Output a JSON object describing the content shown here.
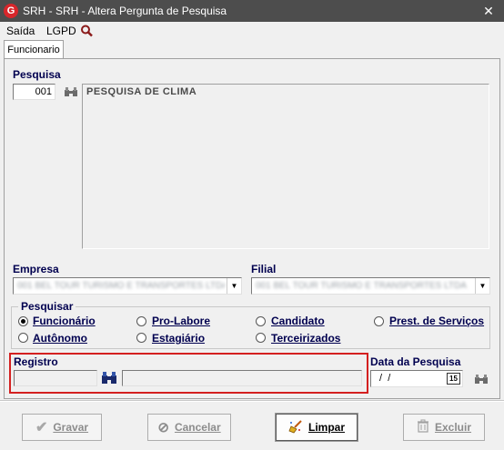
{
  "window": {
    "title": "SRH -  SRH - Altera Pergunta de Pesquisa",
    "close_glyph": "✕",
    "app_icon_letter": "G"
  },
  "menu": {
    "saida": "Saída",
    "lgpd": "LGPD",
    "search_icon": "magnifier-icon"
  },
  "tabs": {
    "funcionario": "Funcionario"
  },
  "pesquisa": {
    "label": "Pesquisa",
    "code": "001",
    "description": "PESQUISA DE CLIMA"
  },
  "empresa": {
    "label": "Empresa",
    "value": "001 BEL TOUR TURISMO E TRANSPORTES LTDA"
  },
  "filial": {
    "label": "Filial",
    "value": "001 BEL TOUR TURISMO E TRANSPORTES LTDA"
  },
  "pesquisar": {
    "label": "Pesquisar",
    "options": [
      "Funcionário",
      "Pro-Labore",
      "Candidato",
      "Prest. de Serviços",
      "Autônomo",
      "Estagiário",
      "Terceirizados"
    ],
    "selected": "Funcionário"
  },
  "registro": {
    "label": "Registro",
    "code": "",
    "name": ""
  },
  "data_pesquisa": {
    "label": "Data da Pesquisa",
    "value": " /  / ",
    "calendar_day": "15"
  },
  "buttons": {
    "gravar": "Gravar",
    "cancelar": "Cancelar",
    "limpar": "Limpar",
    "excluir": "Excluir"
  },
  "colors": {
    "titlebar": "#4d4d4d",
    "label_blue": "#00004f",
    "highlight_red": "#d42020",
    "app_icon": "#d7262b"
  }
}
